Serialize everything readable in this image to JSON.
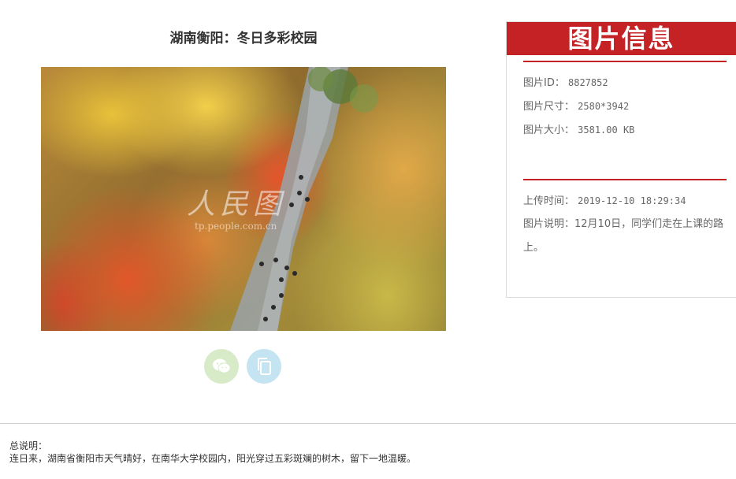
{
  "page": {
    "title": "湖南衡阳：冬日多彩校园"
  },
  "photo": {
    "watermark_main": "人民图",
    "watermark_url": "tp.people.com.cn"
  },
  "share": {
    "wechat_icon": "wechat-icon",
    "copy_icon": "copy-icon"
  },
  "info": {
    "header": "图片信息",
    "id_label": "图片ID：",
    "id_value": "8827852",
    "size_label": "图片尺寸：",
    "size_value": "2580*3942",
    "filesize_label": "图片大小：",
    "filesize_value": "3581.00 KB",
    "upload_label": "上传时间：",
    "upload_value": "2019-12-10 18:29:34",
    "desc_label": "图片说明：",
    "desc_value": "12月10日，同学们走在上课的路上。"
  },
  "summary": {
    "label": "总说明：",
    "text": "连日来，湖南省衡阳市天气晴好，在南华大学校园内，阳光穿过五彩斑斓的树木，留下一地温暖。"
  },
  "colors": {
    "accent": "#c52225",
    "wechat_bg": "#d7ebc9",
    "copy_bg": "#c3e4f0"
  }
}
